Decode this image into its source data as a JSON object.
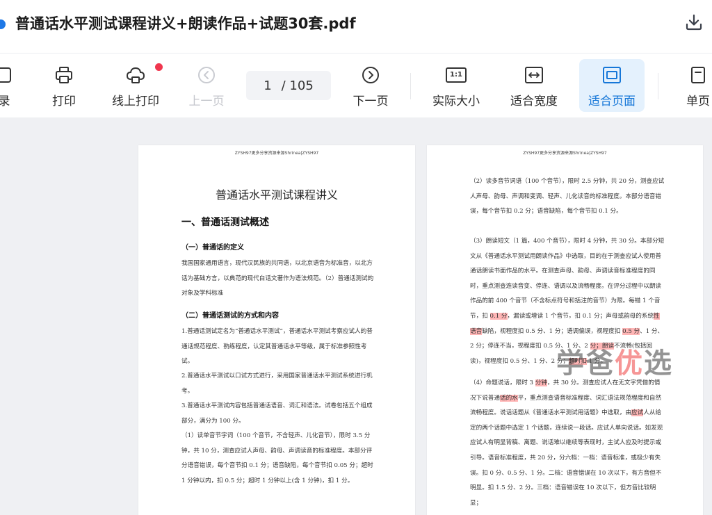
{
  "app": {
    "title": "普通话水平测试课程讲义+朗读作品+试题30套.pdf"
  },
  "toolbar": {
    "catalog_label": "录",
    "print_label": "打印",
    "online_print_label": "线上打印",
    "prev_label": "上一页",
    "page_current": "1",
    "page_total": "/ 105",
    "next_label": "下一页",
    "actual_size_label": "实际大小",
    "fit_width_label": "适合宽度",
    "fit_page_label": "适合页面",
    "single_label": "单页",
    "actual_size_icon_text": "1:1"
  },
  "page1": {
    "header": "ZYSH97更多分享资源来源Shrinea|ZYSH97",
    "title": "普通话水平测试课程讲义",
    "h1": "一、普通话测试概述",
    "h2a": "（一）普通话的定义",
    "p1": "我国国家通用语言，现代汉民族的共同语，以北京语音为标准音，以北方话为基础方言，以典范的现代白话文著作为语法规范。（2）普通话测试的对象及学科标准",
    "h2b": "（二）普通话测试的方式和内容",
    "p2": "1.普通话测试定名为“普通话水平测试”，普通话水平测试考察应试人的普通话规范程度、熟练程度，认定其普通话水平等级，属于标准参照性考试。",
    "p3": "2.普通话水平测试以口试方式进行，采用国家普通话水平测试系统进行机考。",
    "p4": "3.普通话水平测试内容包括普通话语音、词汇和语法。试卷包括五个组成部分，满分为 100 分。",
    "p5": "（1）读单音节字词（100 个音节，不含轻声、儿化音节），限时 3.5 分钟，共 10 分，测查应试人声母、韵母、声调读音的标准程度。本部分评分语音错误，每个音节扣 0.1 分；语音缺陷，每个音节扣 0.05 分；超时 1 分钟以内，扣 0.5 分；超时 1 分钟以上(含 1 分钟)，扣 1 分。"
  },
  "page2": {
    "header": "ZYSH97更多分享资源来源Shrinea|ZYSH97",
    "p1": "（2）读多音节词语（100 个音节），限时 2.5 分钟，共 20 分，测查应试人声母、韵母、声调和变调、轻声、儿化读音的标准程度。本部分语音错误，每个音节扣 0.2 分；语音缺陷，每个音节扣 0.1 分。",
    "p2a": "（3）朗读短文（1 篇，400 个音节），限时 4 分钟，共 30 分。本部分短文从《普通话水平测试用朗读作品》中选取，目的在于测查应试人使用普通话朗读书面作品的水平。在测查声母、韵母、声调读音标准程度的同时，重点测查连读音变、停连、语调以及流畅程度。在评分过程中以朗读作品的前 400 个音节（不含标点符号和括注的音节）为限。每错 1 个音节，扣 ",
    "p2b": "0.1 分",
    "p2c": "，漏读或增读 1 个音节，扣 0.1 分；声母或韵母的系统",
    "p2d": "性语音",
    "p2e": "缺陷，视程度扣 0.5 分、1 分；语调偏误，视程度扣 ",
    "p2f": "0.5 分",
    "p2g": "、1 分、2 分；停连不当，视程度扣 0.5 分、1 分、2 ",
    "p2h": "分；朗读",
    "p2i": "不流畅(包括回读)，视程度扣 0.5 分、1 分、2 分；",
    "p2j": "超时扣",
    "p2k": " 1 分。",
    "p3a": "（4）命题说话，限时 3 ",
    "p3b": "分钟",
    "p3c": "，共 30 分。测查应试人在无文字凭借的情况下说普通",
    "p3d": "话的水",
    "p3e": "平，重点测查语音标准程度、词汇语法规范程度和自然流畅程度。说话话题从《普通话水平测试用话题》中选取，由",
    "p3f": "应试",
    "p3g": "人从给定的两个话题中选定 1 个话题，连续说一段话。应试人单向说话。如发现应试人有明显背稿、离题、说话难以继续等表现时，主试人应及时提示或引导。语音标准程度，共 20 分，分六档：一档：语音标准，或极少有失误。扣 0 分、0.5 分、1 分。二档：语音错误在 10 次以下，有方音但不明显。扣 1.5 分、2 分。三档：语音错误在 10 次以下，但方音比较明显；"
  },
  "watermark": {
    "part1": "学爸",
    "part2": "优",
    "part3": "选"
  }
}
